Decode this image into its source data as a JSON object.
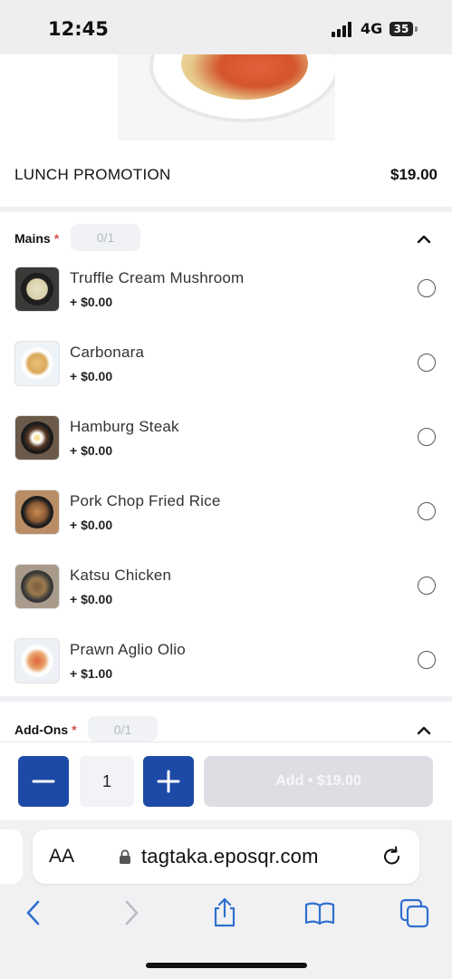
{
  "status_bar": {
    "time": "12:45",
    "network": "4G",
    "battery": "35"
  },
  "product": {
    "title": "LUNCH PROMOTION",
    "price": "$19.00"
  },
  "mains": {
    "title": "Mains",
    "required_mark": "*",
    "counter": "0/1",
    "items": [
      {
        "name": "Truffle Cream Mushroom",
        "price": "+ $0.00"
      },
      {
        "name": "Carbonara",
        "price": "+ $0.00"
      },
      {
        "name": "Hamburg Steak",
        "price": "+ $0.00"
      },
      {
        "name": "Pork Chop Fried Rice",
        "price": "+ $0.00"
      },
      {
        "name": "Katsu Chicken",
        "price": "+ $0.00"
      },
      {
        "name": "Prawn Aglio Olio",
        "price": "+ $1.00"
      }
    ]
  },
  "addons": {
    "title": "Add-Ons",
    "required_mark": "*",
    "counter": "0/1"
  },
  "cart": {
    "quantity": "1",
    "add_label": "Add • $19.00"
  },
  "browser": {
    "text_size_label": "AA",
    "url": "tagtaka.eposqr.com"
  },
  "colors": {
    "accent": "#1d4aa6",
    "required": "#d9534f",
    "disabled_button": "#dcdee3"
  },
  "icons": [
    "minus-icon",
    "plus-icon",
    "chevron-up-icon",
    "lock-icon",
    "reload-icon",
    "back-icon",
    "forward-icon",
    "share-icon",
    "bookmarks-icon",
    "tabs-icon"
  ]
}
